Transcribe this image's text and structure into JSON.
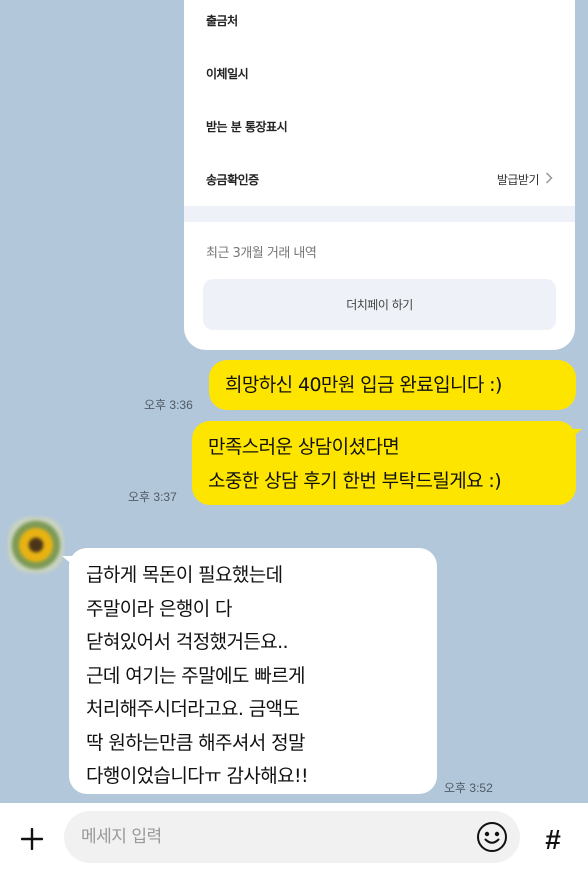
{
  "transfer_card": {
    "rows": [
      {
        "label": "출금처"
      },
      {
        "label": "이체일시"
      },
      {
        "label": "받는 분 통장표시"
      },
      {
        "label": "송금확인증",
        "action": "발급받기"
      }
    ],
    "recent_label": "최근 3개월 거래 내역",
    "dutch_pay_button": "더치페이 하기"
  },
  "messages": [
    {
      "sender": "me",
      "text": "희망하신 40만원 입금 완료입니다 :)",
      "time": "오후 3:36"
    },
    {
      "sender": "me",
      "lines": [
        "만족스러운 상담이셨다면",
        "소중한 상담 후기 한번 부탁드릴게요 :)"
      ],
      "time": "오후 3:37"
    },
    {
      "sender": "other",
      "avatar_icon": "sunflower-avatar",
      "lines": [
        "급하게 목돈이 필요했는데",
        "주말이라 은행이 다",
        "닫혀있어서 걱정했거든요..",
        "근데 여기는 주말에도 빠르게",
        "처리해주시더라고요. 금액도",
        "딱 원하는만큼 해주셔서 정말",
        "다행이었습니다ㅠ 감사해요!!"
      ],
      "time": "오후 3:52"
    }
  ],
  "input_bar": {
    "plus_icon": "plus-icon",
    "placeholder": "메세지 입력",
    "emoji_icon": "emoji-icon",
    "hash_label": "#"
  },
  "colors": {
    "chat_background": "#b2c7da",
    "my_bubble": "#fee500",
    "other_bubble": "#ffffff"
  }
}
